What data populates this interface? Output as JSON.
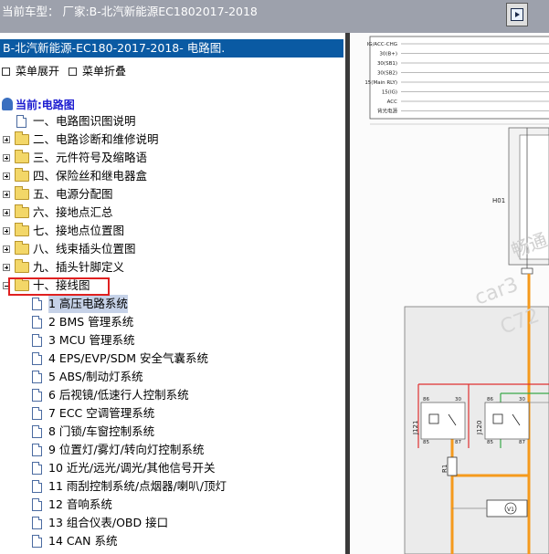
{
  "window": {
    "title": "当前车型：  厂家:B-北汽新能源EC1802017-2018"
  },
  "panel": {
    "header": "B-北汽新能源-EC180-2017-2018- 电路图.",
    "expand_label": "菜单展开",
    "collapse_label": "菜单折叠",
    "root_label": "当前:电路图"
  },
  "tree": {
    "chapters": [
      {
        "label": "一、电路图识图说明",
        "kind": "doc"
      },
      {
        "label": "二、电路诊断和维修说明",
        "kind": "folder"
      },
      {
        "label": "三、元件符号及缩略语",
        "kind": "folder"
      },
      {
        "label": "四、保险丝和继电器盒",
        "kind": "folder"
      },
      {
        "label": "五、电源分配图",
        "kind": "folder"
      },
      {
        "label": "六、接地点汇总",
        "kind": "folder"
      },
      {
        "label": "七、接地点位置图",
        "kind": "folder"
      },
      {
        "label": "八、线束插头位置图",
        "kind": "folder"
      },
      {
        "label": "九、插头针脚定义",
        "kind": "folder"
      },
      {
        "label": "十、接线图",
        "kind": "folder-open"
      }
    ],
    "subitems": [
      {
        "label": "1 高压电路系统",
        "selected": true
      },
      {
        "label": "2 BMS 管理系统"
      },
      {
        "label": "3 MCU 管理系统"
      },
      {
        "label": "4 EPS/EVP/SDM 安全气囊系统"
      },
      {
        "label": "5 ABS/制动灯系统"
      },
      {
        "label": "6 后视镜/低速行人控制系统"
      },
      {
        "label": "7 ECC 空调管理系统"
      },
      {
        "label": "8 门锁/车窗控制系统"
      },
      {
        "label": "9 位置灯/雾灯/转向灯控制系统"
      },
      {
        "label": "10 近光/远光/调光/其他信号开关"
      },
      {
        "label": "11 雨刮控制系统/点烟器/喇叭/顶灯"
      },
      {
        "label": "12 音响系统"
      },
      {
        "label": "13 组合仪表/OBD 接口"
      },
      {
        "label": "14 CAN 系统"
      }
    ]
  },
  "diagram": {
    "power_labels": [
      "IG/ACC-CHG",
      "30(B+)",
      "30(SB1)",
      "30(SB2)",
      "15(Main RLY)",
      "15(IG)",
      "ACC",
      "背光电源"
    ],
    "component_h01": "H01",
    "relay_j121": "J121",
    "relay_j120": "J120",
    "pin_labels": [
      "86",
      "30",
      "85",
      "87",
      "86",
      "30",
      "85",
      "87"
    ],
    "resistor": "R1",
    "meter": "V1",
    "watermark": [
      "畅通",
      "car3",
      "C72"
    ]
  },
  "colors": {
    "topbar": "#9da1ac",
    "header": "#0a5aa3",
    "selection": "#c6d2e8",
    "highlight_box": "#e02020",
    "wire_orange": "#f59a1c",
    "wire_red": "#e03030",
    "wire_green": "#3aa84a"
  },
  "icons": [
    "restore-window-icon",
    "root-book-icon",
    "folder-icon",
    "document-icon",
    "expand-toggle-icon"
  ]
}
